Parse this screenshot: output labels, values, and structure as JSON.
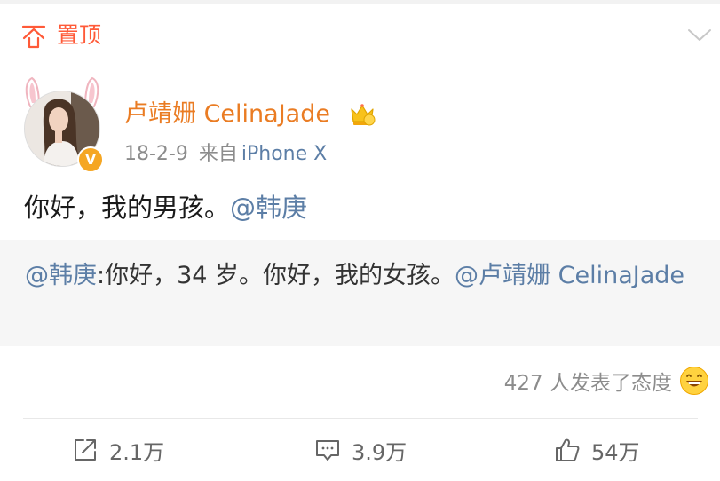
{
  "pinned": {
    "label": "置顶"
  },
  "author": {
    "name": "卢靖姗 CelinaJade"
  },
  "meta": {
    "time": "18-2-9",
    "source": "来自",
    "device": "iPhone X"
  },
  "post": {
    "text": "你好，我的男孩。",
    "mention": "@韩庚"
  },
  "repost": {
    "mention": "@韩庚",
    "text": ":你好，34 岁。你好，我的女孩。",
    "mention2": "@卢靖姗 CelinaJade"
  },
  "reactions": {
    "text": "427 人发表了态度"
  },
  "actions": {
    "repost": "2.1万",
    "comment": "3.9万",
    "like": "54万"
  },
  "colors": {
    "accent": "#ff5a38",
    "name": "#ea7c23",
    "link": "#5c7ea6",
    "verified": "#f5a623"
  }
}
